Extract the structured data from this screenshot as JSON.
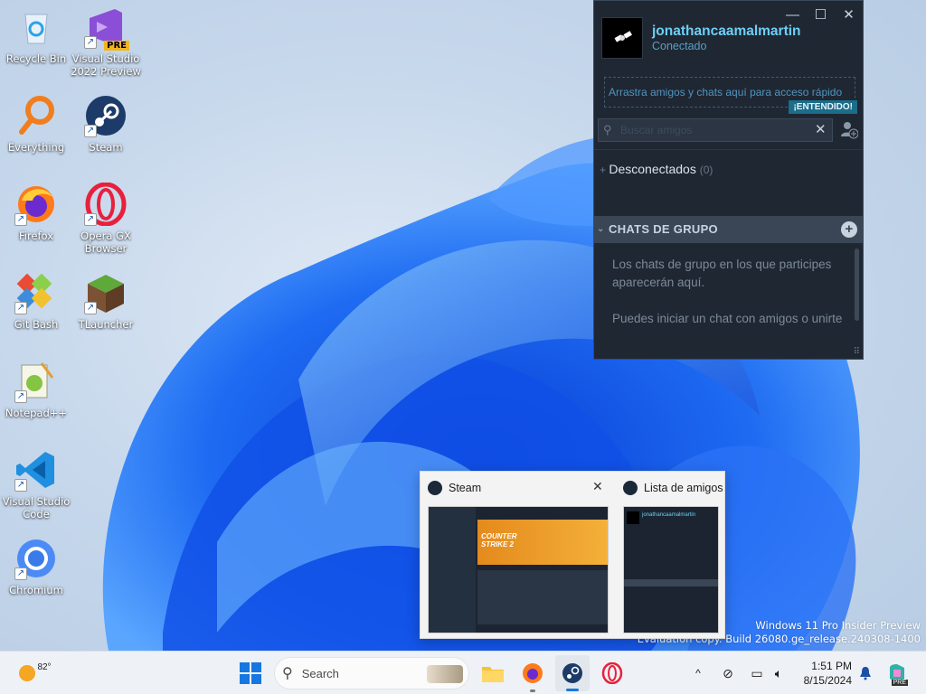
{
  "desktop": {
    "icons": [
      {
        "label": "Recycle Bin",
        "icon": "recycle-bin-icon"
      },
      {
        "label": "Visual Studio 2022 Preview",
        "icon": "visual-studio-icon",
        "badge": "PRE"
      },
      {
        "label": "Everything",
        "icon": "everything-search-icon"
      },
      {
        "label": "Steam",
        "icon": "steam-icon"
      },
      {
        "label": "Firefox",
        "icon": "firefox-icon"
      },
      {
        "label": "Opera GX Browser",
        "icon": "opera-gx-icon"
      },
      {
        "label": "Git Bash",
        "icon": "git-bash-icon"
      },
      {
        "label": "TLauncher",
        "icon": "tlauncher-icon"
      },
      {
        "label": "Notepad++",
        "icon": "notepad-plus-plus-icon"
      },
      {
        "label": "Visual Studio Code",
        "icon": "vscode-icon"
      },
      {
        "label": "Chromium",
        "icon": "chromium-icon"
      }
    ]
  },
  "friends_window": {
    "username": "jonathancaamalmartin",
    "status": "Conectado",
    "drop_hint": "Arrastra amigos y chats aquí para acceso rápido",
    "got_it": "¡ENTENDIDO!",
    "search_placeholder": "Buscar amigos",
    "offline_label": "Desconectados",
    "offline_count": "(0)",
    "group_chats_header": "CHATS DE GRUPO",
    "group_text_1": "Los chats de grupo en los que participes aparecerán aquí.",
    "group_text_2": "Puedes iniciar un chat con amigos o unirte al chat de un grupo de Steam."
  },
  "preview": {
    "steam_title": "Steam",
    "friends_title": "Lista de amigos",
    "game_banner": "COUNTER STRIKE 2",
    "mini_username": "jonathancaamalmartin"
  },
  "watermark": {
    "line1": "Windows 11 Pro Insider Preview",
    "line2": "Evaluation copy. Build 26080.ge_release.240308-1400"
  },
  "taskbar": {
    "weather_temp": "82°",
    "search_placeholder": "Search",
    "time": "1:51 PM",
    "date": "8/15/2024"
  },
  "colors": {
    "steam_bg": "#1f2733",
    "steam_accent": "#6dcff6",
    "taskbar_bg": "#eef1f6"
  }
}
